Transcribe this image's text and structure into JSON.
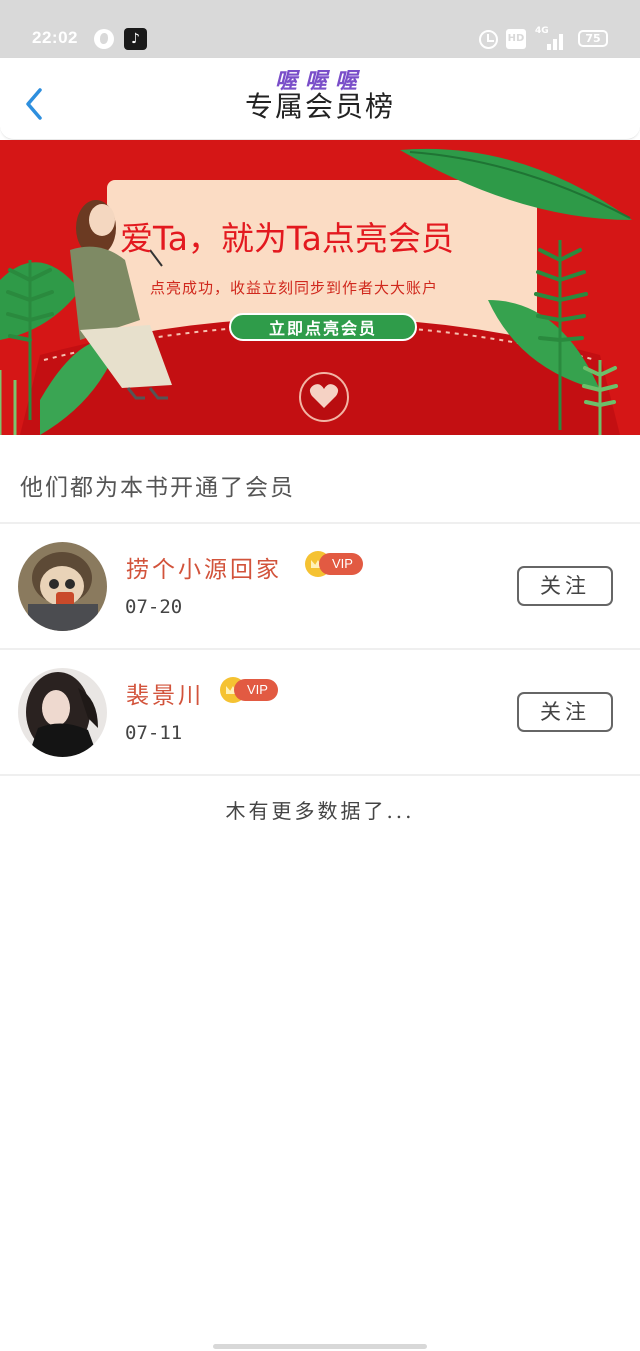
{
  "status_bar": {
    "time": "22:02",
    "battery": "75",
    "network": "4G",
    "hd_label": "HD",
    "tiktok_glyph": "♪",
    "icons": [
      "globe-icon",
      "tiktok-icon",
      "alarm-icon",
      "hd-icon",
      "signal-icon",
      "battery-icon"
    ]
  },
  "header": {
    "title": "专属会员榜",
    "overlay": "喔喔喔",
    "back_icon": "chevron-left-icon",
    "accent_color": "#2e8fde"
  },
  "banner": {
    "headline": "爱Ta，就为Ta点亮会员",
    "subtitle": "点亮成功，收益立刻同步到作者大大账户",
    "cta_label": "立即点亮会员",
    "background_color": "#d51616"
  },
  "members_section": {
    "heading": "他们都为本书开通了会员",
    "vip_label": "VIP",
    "follow_label": "关注",
    "members": [
      {
        "name": "捞个小源回家",
        "date": "07-20"
      },
      {
        "name": "裴景川",
        "date": "07-11"
      }
    ],
    "name_color": "#d2533b"
  },
  "footer": {
    "no_more_text": "木有更多数据了..."
  }
}
